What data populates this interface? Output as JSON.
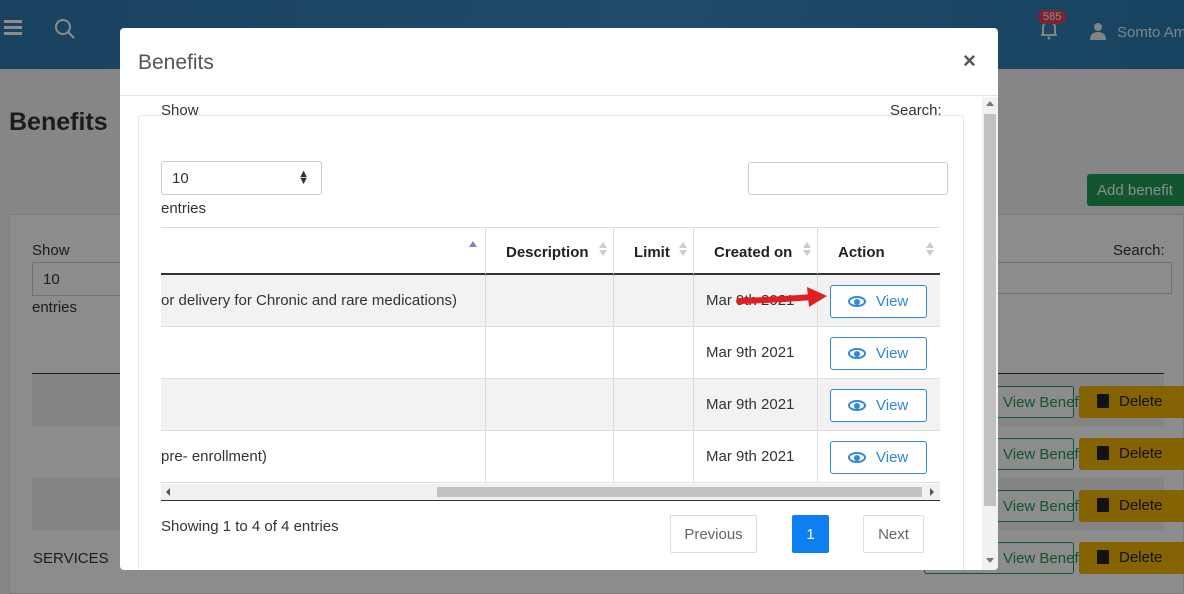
{
  "topbar": {
    "notifications_count": "585",
    "user_name": "Somto Am"
  },
  "background": {
    "title": "Benefits",
    "add_button": "Add benefit",
    "show_label": "Show",
    "length_value": "10",
    "entries_label": "entries",
    "search_label": "Search:",
    "services_text": "SERVICES",
    "view_benefit_label": "View Benefit",
    "delete_label": "Delete"
  },
  "modal": {
    "title": "Benefits",
    "close_label": "×",
    "show_label": "Show",
    "length_value": "10",
    "entries_label": "entries",
    "search_label": "Search:",
    "columns": {
      "name": "",
      "description": "Description",
      "limit": "Limit",
      "created_on": "Created on",
      "action": "Action"
    },
    "rows": [
      {
        "name": "or delivery for Chronic and rare medications)",
        "description": "",
        "limit": "",
        "created_on": "Mar 9th 2021",
        "action": "View"
      },
      {
        "name": "",
        "description": "",
        "limit": "",
        "created_on": "Mar 9th 2021",
        "action": "View"
      },
      {
        "name": "",
        "description": "",
        "limit": "",
        "created_on": "Mar 9th 2021",
        "action": "View"
      },
      {
        "name": "pre- enrollment)",
        "description": "",
        "limit": "",
        "created_on": "Mar 9th 2021",
        "action": "View"
      }
    ],
    "info_text": "Showing 1 to 4 of 4 entries",
    "pagination": {
      "previous": "Previous",
      "current": "1",
      "next": "Next"
    }
  },
  "colors": {
    "accent": "#2e86de",
    "active_page": "#0d7ff0",
    "annotation_arrow": "#e02020",
    "add_button": "#1f9d55",
    "delete_button": "#f0b500"
  }
}
